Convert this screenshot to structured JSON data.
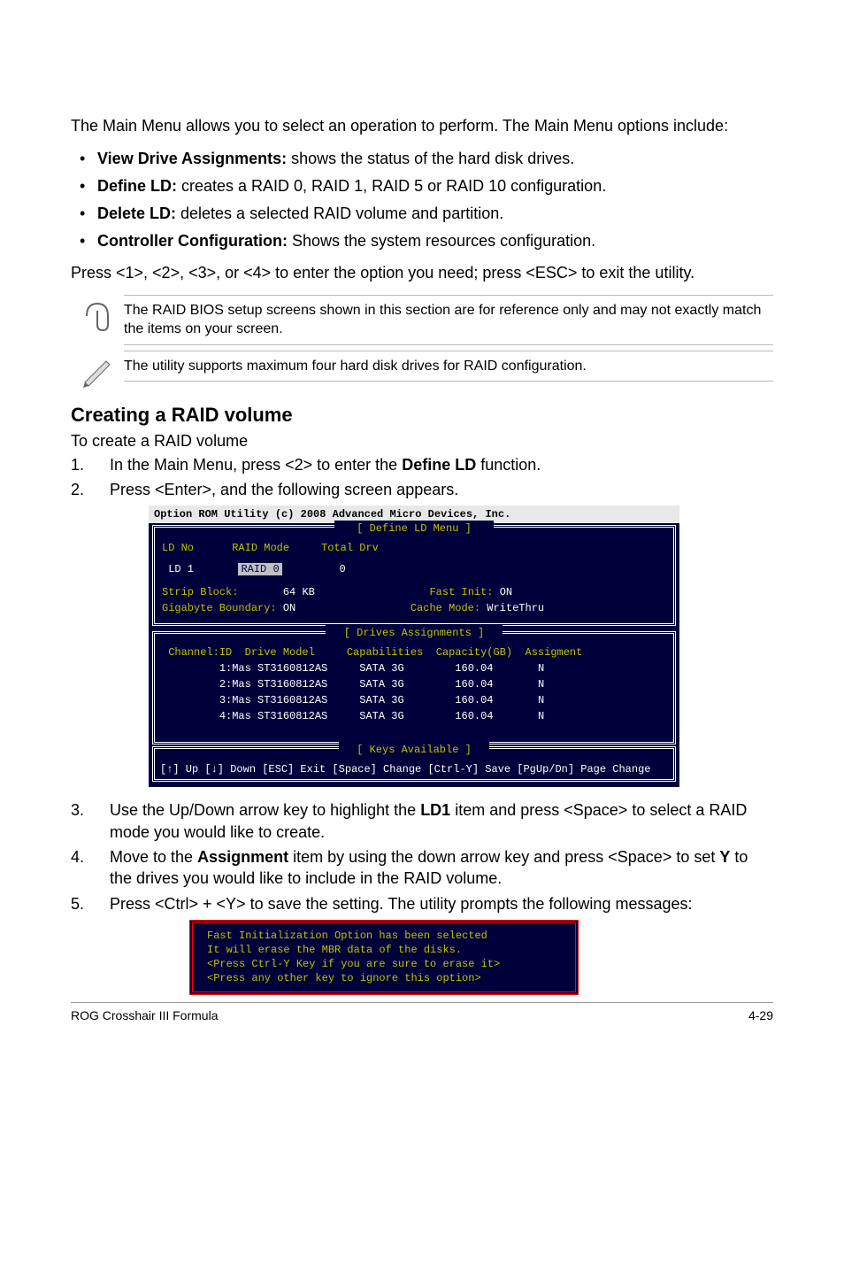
{
  "intro": "The Main Menu allows you to select an operation to perform. The Main Menu options include:",
  "bullets": [
    {
      "label": "View Drive Assignments:",
      "desc": " shows the status of the hard disk drives."
    },
    {
      "label": "Define LD:",
      "desc": " creates a RAID 0, RAID 1, RAID 5 or RAID 10 configuration."
    },
    {
      "label": "Delete LD:",
      "desc": " deletes a selected RAID volume and partition."
    },
    {
      "label": "Controller Configuration:",
      "desc": " Shows the system resources configuration."
    }
  ],
  "press": "Press <1>, <2>, <3>, or <4> to enter the option you need; press <ESC> to exit the utility.",
  "note1": "The RAID BIOS setup screens shown in this section are for reference only and may not exactly match the items on your screen.",
  "note2": "The utility supports maximum four hard disk drives for RAID configuration.",
  "section": "Creating a RAID volume",
  "subline": "To create a RAID volume",
  "step1_a": "In the Main Menu, press <2> to enter the ",
  "step1_b": "Define LD",
  "step1_c": " function.",
  "step2": "Press <Enter>, and the following screen appears.",
  "bios": {
    "title": "Option ROM Utility (c) 2008 Advanced Micro Devices, Inc.",
    "tab1": "[ Define LD Menu ]",
    "hdr": {
      "ld": "LD No",
      "mode": "RAID Mode",
      "total": "Total Drv"
    },
    "ld1": {
      "ld": "LD 1",
      "mode": "RAID 0",
      "total": "0"
    },
    "strip_l": "Strip Block:",
    "strip_v": "64 KB",
    "fast_l": "Fast Init:",
    "fast_v": "ON",
    "gb_l": "Gigabyte Boundary:",
    "gb_v": "ON",
    "cache_l": "Cache Mode:",
    "cache_v": "WriteThru",
    "tab2": "[ Drives Assignments ]",
    "dhdr": {
      "c": "Channel:ID",
      "m": "Drive Model",
      "cap": "Capabilities",
      "gb": "Capacity(GB)",
      "a": "Assigment"
    },
    "drives": [
      {
        "c": "1:Mas",
        "m": "ST3160812AS",
        "cap": "SATA 3G",
        "gb": "160.04",
        "a": "N"
      },
      {
        "c": "2:Mas",
        "m": "ST3160812AS",
        "cap": "SATA 3G",
        "gb": "160.04",
        "a": "N"
      },
      {
        "c": "3:Mas",
        "m": "ST3160812AS",
        "cap": "SATA 3G",
        "gb": "160.04",
        "a": "N"
      },
      {
        "c": "4:Mas",
        "m": "ST3160812AS",
        "cap": "SATA 3G",
        "gb": "160.04",
        "a": "N"
      }
    ],
    "tab3": "[ Keys Available ]",
    "keys": "[↑] Up [↓] Down [ESC] Exit [Space] Change [Ctrl-Y] Save [PgUp/Dn] Page Change"
  },
  "step3_a": "Use the Up/Down arrow key to highlight the ",
  "step3_b": "LD1",
  "step3_c": " item and press <Space> to select a RAID mode you would like to create.",
  "step4_a": "Move to the ",
  "step4_b": "Assignment",
  "step4_c": " item by using the down arrow key and press <Space> to set ",
  "step4_d": "Y",
  "step4_e": " to the drives you would like to include in the RAID volume.",
  "step5": "Press <Ctrl> + <Y> to save the setting. The utility prompts the following messages:",
  "dlg": [
    "Fast Initialization Option has been selected",
    "It will erase the MBR data of the disks.",
    "<Press Ctrl-Y Key if you are sure to erase it>",
    "<Press any other key to ignore this option>"
  ],
  "footer_l": "ROG Crosshair III Formula",
  "footer_r": "4-29"
}
